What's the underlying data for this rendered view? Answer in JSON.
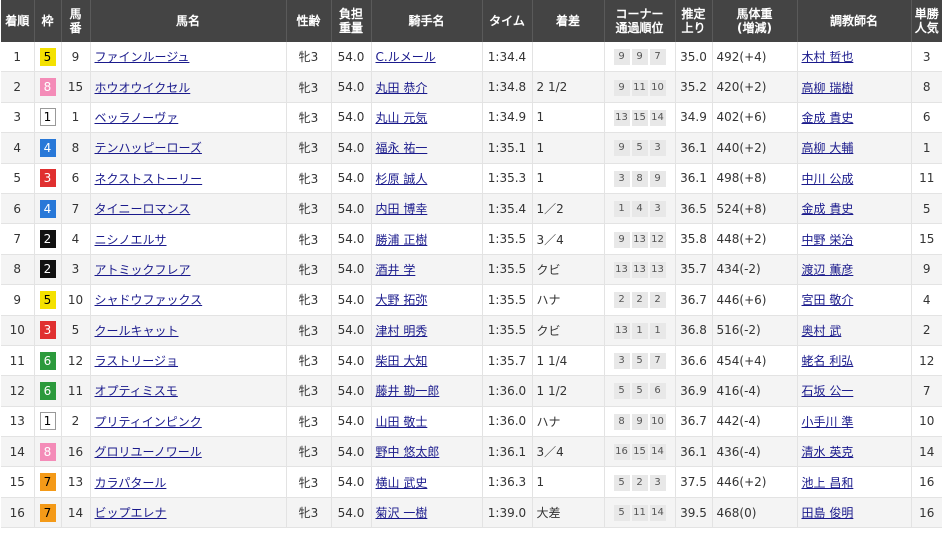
{
  "headers": [
    "着順",
    "枠",
    "馬番",
    "馬名",
    "性齢",
    "負担重量",
    "騎手名",
    "タイム",
    "着差",
    "コーナー通過順位",
    "推定上り",
    "馬体重(増減)",
    "調教師名",
    "単勝人気"
  ],
  "rows": [
    {
      "rank": "1",
      "waku": "5",
      "num": "9",
      "horse": "ファインルージュ",
      "sex": "牝3",
      "weight": "54.0",
      "jockey": "C.ルメール",
      "time": "1:34.4",
      "margin": "",
      "corner": [
        "9",
        "9",
        "7"
      ],
      "last": "35.0",
      "body": "492(+4)",
      "trainer": "木村 哲也",
      "pop": "3"
    },
    {
      "rank": "2",
      "waku": "8",
      "num": "15",
      "horse": "ホウオウイクセル",
      "sex": "牝3",
      "weight": "54.0",
      "jockey": "丸田 恭介",
      "time": "1:34.8",
      "margin": "2 1/2",
      "corner": [
        "9",
        "11",
        "10"
      ],
      "last": "35.2",
      "body": "420(+2)",
      "trainer": "高柳 瑞樹",
      "pop": "8"
    },
    {
      "rank": "3",
      "waku": "1",
      "num": "1",
      "horse": "ベッラノーヴァ",
      "sex": "牝3",
      "weight": "54.0",
      "jockey": "丸山 元気",
      "time": "1:34.9",
      "margin": "1",
      "corner": [
        "13",
        "15",
        "14"
      ],
      "last": "34.9",
      "body": "402(+6)",
      "trainer": "金成 貴史",
      "pop": "6"
    },
    {
      "rank": "4",
      "waku": "4",
      "num": "8",
      "horse": "テンハッピーローズ",
      "sex": "牝3",
      "weight": "54.0",
      "jockey": "福永 祐一",
      "time": "1:35.1",
      "margin": "1",
      "corner": [
        "9",
        "5",
        "3"
      ],
      "last": "36.1",
      "body": "440(+2)",
      "trainer": "高柳 大輔",
      "pop": "1"
    },
    {
      "rank": "5",
      "waku": "3",
      "num": "6",
      "horse": "ネクストストーリー",
      "sex": "牝3",
      "weight": "54.0",
      "jockey": "杉原 誠人",
      "time": "1:35.3",
      "margin": "1",
      "corner": [
        "3",
        "8",
        "9"
      ],
      "last": "36.1",
      "body": "498(+8)",
      "trainer": "中川 公成",
      "pop": "11"
    },
    {
      "rank": "6",
      "waku": "4",
      "num": "7",
      "horse": "タイニーロマンス",
      "sex": "牝3",
      "weight": "54.0",
      "jockey": "内田 博幸",
      "time": "1:35.4",
      "margin": "1／2",
      "corner": [
        "1",
        "4",
        "3"
      ],
      "last": "36.5",
      "body": "524(+8)",
      "trainer": "金成 貴史",
      "pop": "5"
    },
    {
      "rank": "7",
      "waku": "2",
      "num": "4",
      "horse": "ニシノエルサ",
      "sex": "牝3",
      "weight": "54.0",
      "jockey": "勝浦 正樹",
      "time": "1:35.5",
      "margin": "3／4",
      "corner": [
        "9",
        "13",
        "12"
      ],
      "last": "35.8",
      "body": "448(+2)",
      "trainer": "中野 栄治",
      "pop": "15"
    },
    {
      "rank": "8",
      "waku": "2",
      "num": "3",
      "horse": "アトミックフレア",
      "sex": "牝3",
      "weight": "54.0",
      "jockey": "酒井 学",
      "time": "1:35.5",
      "margin": "クビ",
      "corner": [
        "13",
        "13",
        "13"
      ],
      "last": "35.7",
      "body": "434(-2)",
      "trainer": "渡辺 薫彦",
      "pop": "9"
    },
    {
      "rank": "9",
      "waku": "5",
      "num": "10",
      "horse": "シャドウファックス",
      "sex": "牝3",
      "weight": "54.0",
      "jockey": "大野 拓弥",
      "time": "1:35.5",
      "margin": "ハナ",
      "corner": [
        "2",
        "2",
        "2"
      ],
      "last": "36.7",
      "body": "446(+6)",
      "trainer": "宮田 敬介",
      "pop": "4"
    },
    {
      "rank": "10",
      "waku": "3",
      "num": "5",
      "horse": "クールキャット",
      "sex": "牝3",
      "weight": "54.0",
      "jockey": "津村 明秀",
      "time": "1:35.5",
      "margin": "クビ",
      "corner": [
        "13",
        "1",
        "1"
      ],
      "last": "36.8",
      "body": "516(-2)",
      "trainer": "奥村 武",
      "pop": "2"
    },
    {
      "rank": "11",
      "waku": "6",
      "num": "12",
      "horse": "ラストリージョ",
      "sex": "牝3",
      "weight": "54.0",
      "jockey": "柴田 大知",
      "time": "1:35.7",
      "margin": "1 1/4",
      "corner": [
        "3",
        "5",
        "7"
      ],
      "last": "36.6",
      "body": "454(+4)",
      "trainer": "蛯名 利弘",
      "pop": "12"
    },
    {
      "rank": "12",
      "waku": "6",
      "num": "11",
      "horse": "オプティミスモ",
      "sex": "牝3",
      "weight": "54.0",
      "jockey": "藤井 勘一郎",
      "time": "1:36.0",
      "margin": "1 1/2",
      "corner": [
        "5",
        "5",
        "6"
      ],
      "last": "36.9",
      "body": "416(-4)",
      "trainer": "石坂 公一",
      "pop": "7"
    },
    {
      "rank": "13",
      "waku": "1",
      "num": "2",
      "horse": "プリティインピンク",
      "sex": "牝3",
      "weight": "54.0",
      "jockey": "山田 敬士",
      "time": "1:36.0",
      "margin": "ハナ",
      "corner": [
        "8",
        "9",
        "10"
      ],
      "last": "36.7",
      "body": "442(-4)",
      "trainer": "小手川 準",
      "pop": "10"
    },
    {
      "rank": "14",
      "waku": "8",
      "num": "16",
      "horse": "グロリユーノワール",
      "sex": "牝3",
      "weight": "54.0",
      "jockey": "野中 悠太郎",
      "time": "1:36.1",
      "margin": "3／4",
      "corner": [
        "16",
        "15",
        "14"
      ],
      "last": "36.1",
      "body": "436(-4)",
      "trainer": "清水 英克",
      "pop": "14"
    },
    {
      "rank": "15",
      "waku": "7",
      "num": "13",
      "horse": "カラパタール",
      "sex": "牝3",
      "weight": "54.0",
      "jockey": "横山 武史",
      "time": "1:36.3",
      "margin": "1",
      "corner": [
        "5",
        "2",
        "3"
      ],
      "last": "37.5",
      "body": "446(+2)",
      "trainer": "池上 昌和",
      "pop": "16"
    },
    {
      "rank": "16",
      "waku": "7",
      "num": "14",
      "horse": "ビップエレナ",
      "sex": "牝3",
      "weight": "54.0",
      "jockey": "菊沢 一樹",
      "time": "1:39.0",
      "margin": "大差",
      "corner": [
        "5",
        "11",
        "14"
      ],
      "last": "39.5",
      "body": "468(0)",
      "trainer": "田島 俊明",
      "pop": "16"
    }
  ]
}
